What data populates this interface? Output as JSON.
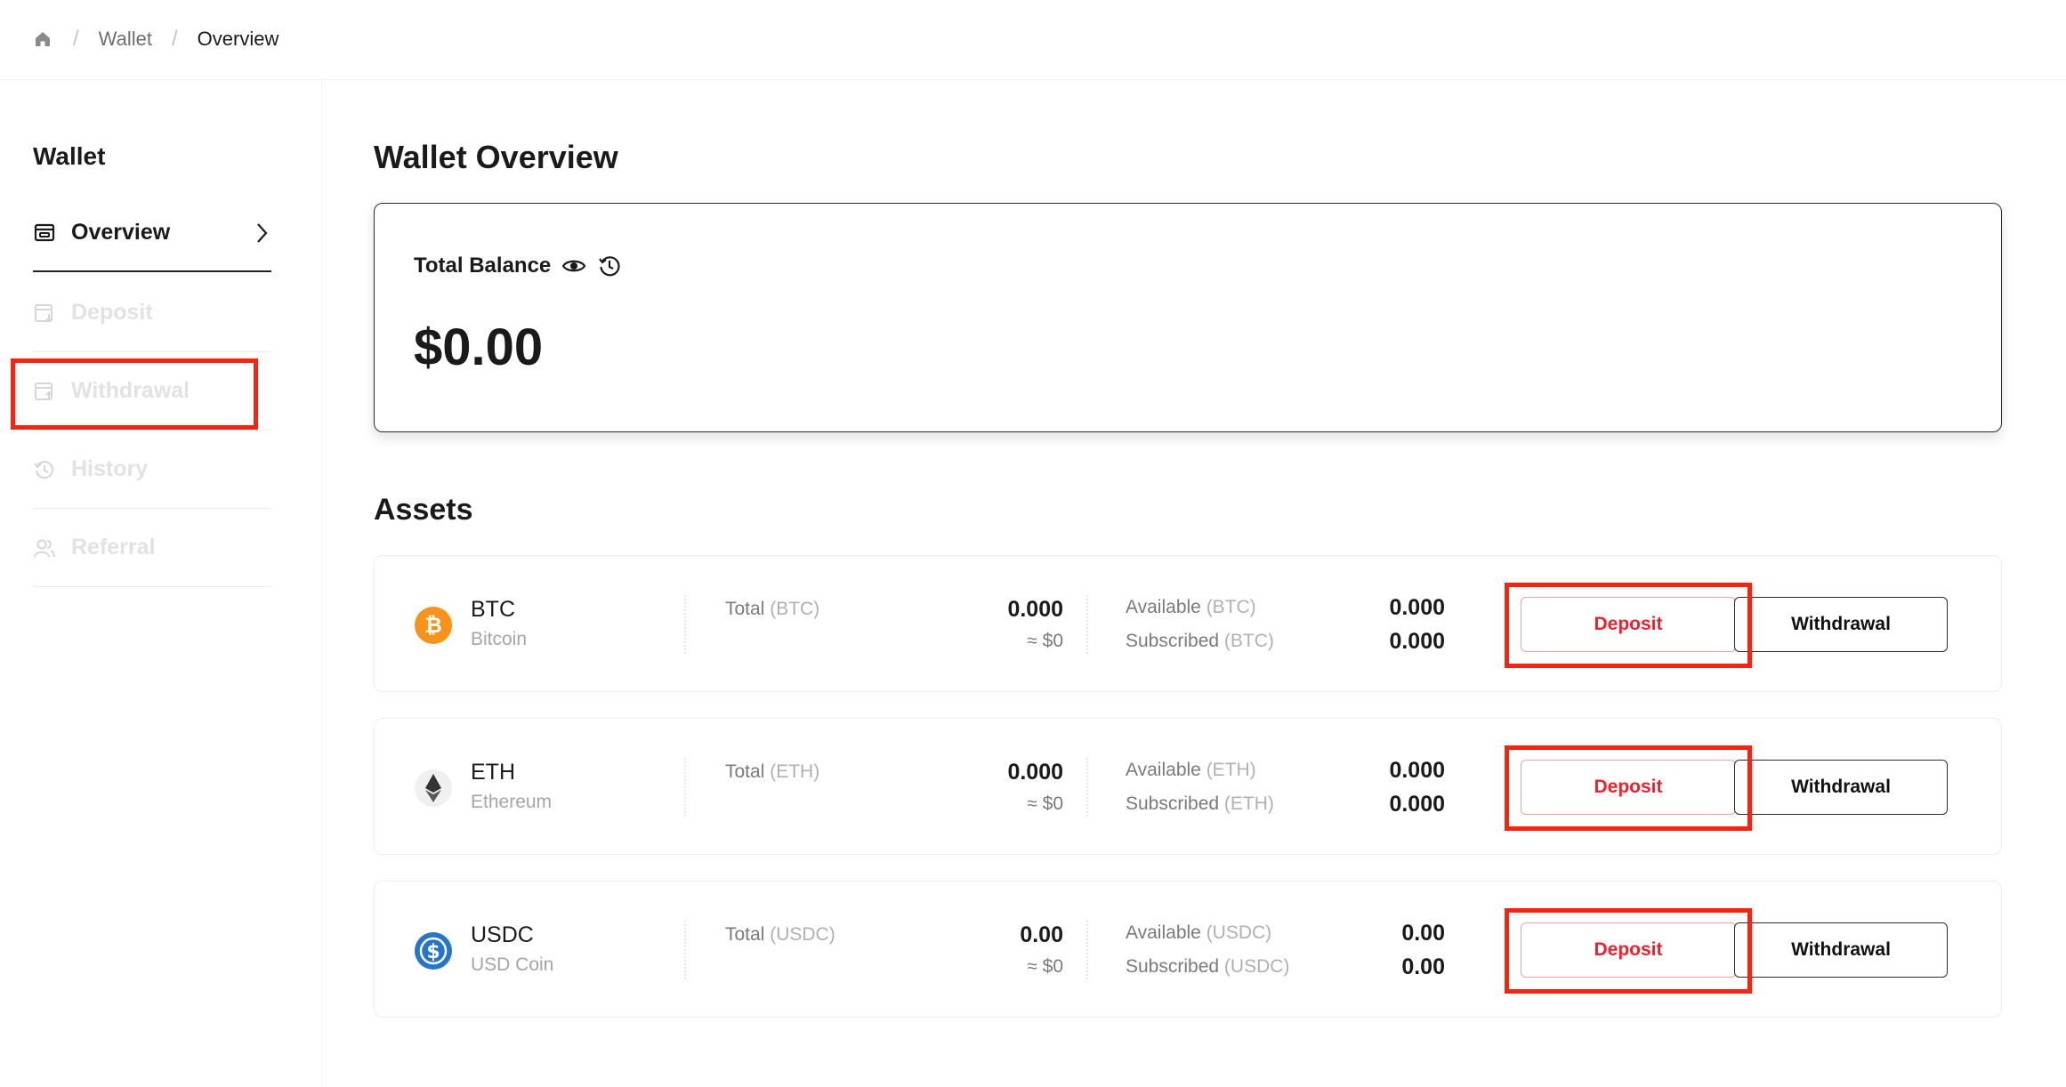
{
  "breadcrumb": {
    "items": [
      "Wallet",
      "Overview"
    ]
  },
  "sidebar": {
    "title": "Wallet",
    "items": [
      {
        "label": "Overview",
        "icon": "wallet-icon"
      },
      {
        "label": "Deposit",
        "icon": "deposit-icon"
      },
      {
        "label": "Withdrawal",
        "icon": "withdrawal-icon"
      },
      {
        "label": "History",
        "icon": "history-icon"
      },
      {
        "label": "Referral",
        "icon": "referral-icon"
      }
    ]
  },
  "main": {
    "title": "Wallet Overview",
    "balance": {
      "label": "Total Balance",
      "value": "$0.00"
    },
    "assets_title": "Assets",
    "assets": [
      {
        "symbol": "BTC",
        "name": "Bitcoin",
        "total_label": "Total",
        "total_unit": "(BTC)",
        "total": "0.000",
        "total_usd": "≈ $0",
        "available_label": "Available",
        "available_unit": "(BTC)",
        "available": "0.000",
        "subscribed_label": "Subscribed",
        "subscribed_unit": "(BTC)",
        "subscribed": "0.000",
        "deposit_label": "Deposit",
        "withdrawal_label": "Withdrawal",
        "icon": "bitcoin-icon",
        "color": "#f7931a"
      },
      {
        "symbol": "ETH",
        "name": "Ethereum",
        "total_label": "Total",
        "total_unit": "(ETH)",
        "total": "0.000",
        "total_usd": "≈ $0",
        "available_label": "Available",
        "available_unit": "(ETH)",
        "available": "0.000",
        "subscribed_label": "Subscribed",
        "subscribed_unit": "(ETH)",
        "subscribed": "0.000",
        "deposit_label": "Deposit",
        "withdrawal_label": "Withdrawal",
        "icon": "ethereum-icon",
        "color": "#343434"
      },
      {
        "symbol": "USDC",
        "name": "USD Coin",
        "total_label": "Total",
        "total_unit": "(USDC)",
        "total": "0.00",
        "total_usd": "≈ $0",
        "available_label": "Available",
        "available_unit": "(USDC)",
        "available": "0.00",
        "subscribed_label": "Subscribed",
        "subscribed_unit": "(USDC)",
        "subscribed": "0.00",
        "deposit_label": "Deposit",
        "withdrawal_label": "Withdrawal",
        "icon": "usdc-icon",
        "color": "#2775ca"
      }
    ]
  },
  "colors": {
    "accent": "#ef1f2b",
    "highlight": "#f5230f",
    "text": "#1a1a1a",
    "muted": "#a5a5a5"
  }
}
